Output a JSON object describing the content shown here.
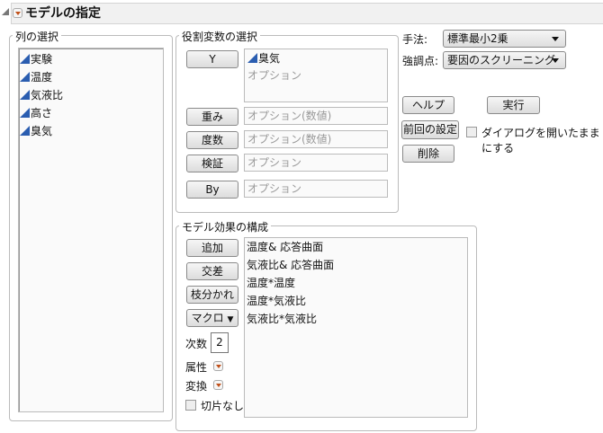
{
  "header": {
    "title": "モデルの指定"
  },
  "columns": {
    "label": "列の選択",
    "items": [
      "実験",
      "温度",
      "気液比",
      "高さ",
      "臭気"
    ]
  },
  "roles": {
    "label": "役割変数の選択",
    "y": {
      "button": "Y",
      "value": "臭気",
      "placeholder": "オプション"
    },
    "weight": {
      "button": "重み",
      "placeholder": "オプション(数値)"
    },
    "freq": {
      "button": "度数",
      "placeholder": "オプション(数値)"
    },
    "validation": {
      "button": "検証",
      "placeholder": "オプション"
    },
    "by": {
      "button": "By",
      "placeholder": "オプション"
    }
  },
  "options": {
    "method_label": "手法:",
    "method_value": "標準最小2乗",
    "emphasis_label": "強調点:",
    "emphasis_value": "要因のスクリーニング"
  },
  "actions": {
    "help": "ヘルプ",
    "run": "実行",
    "recall": "前回の設定",
    "keep_open": "ダイアログを開いたままにする",
    "remove": "削除"
  },
  "effects": {
    "label": "モデル効果の構成",
    "add": "追加",
    "cross": "交差",
    "nest": "枝分かれ",
    "macros": "マクロ",
    "degree_label": "次数",
    "degree_value": "2",
    "attributes": "属性",
    "transform": "変換",
    "no_intercept": "切片なし",
    "items": [
      "温度& 応答曲面",
      "気液比& 応答曲面",
      "温度*温度",
      "温度*気液比",
      "気液比*気液比"
    ]
  }
}
